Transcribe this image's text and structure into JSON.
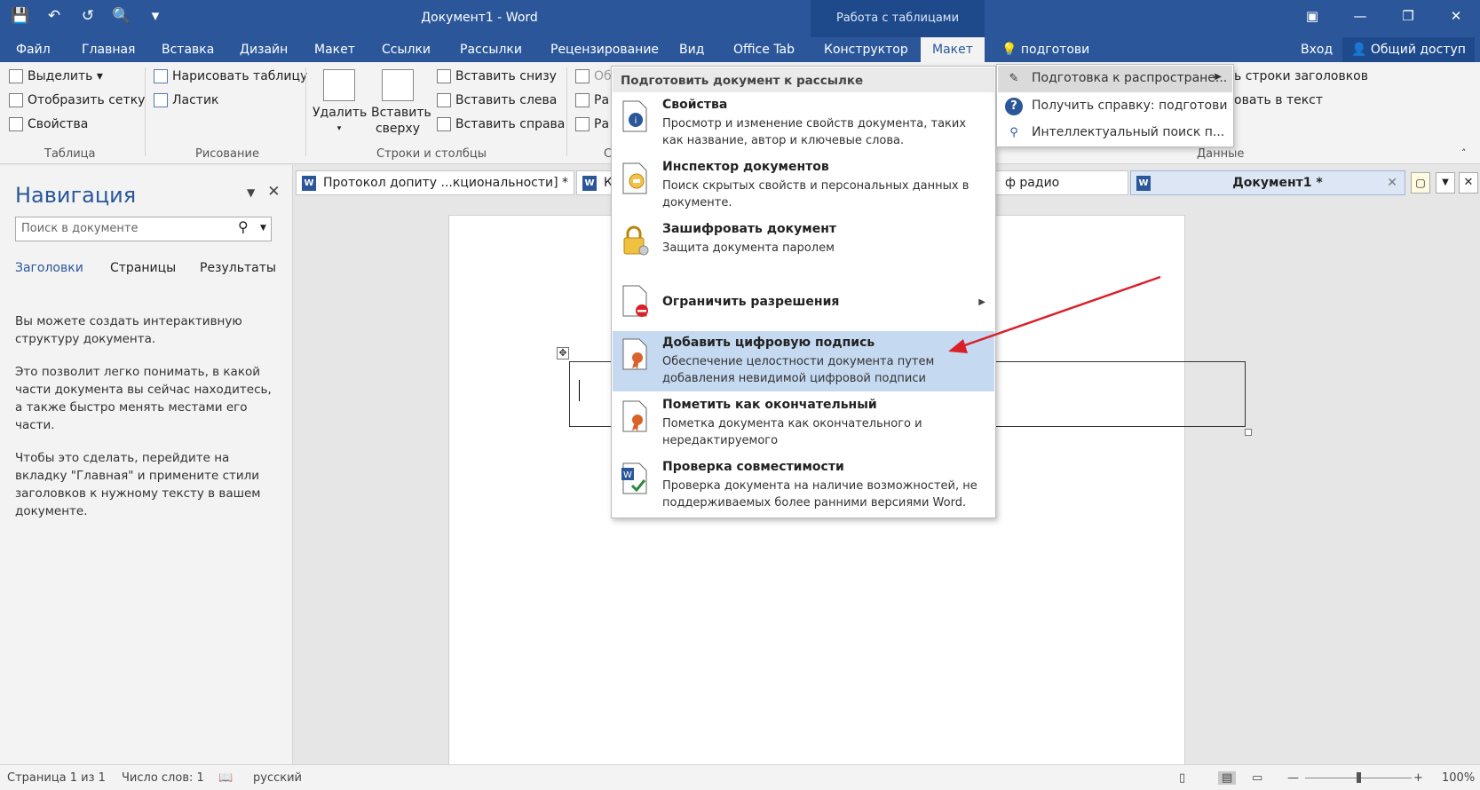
{
  "window": {
    "title": "Документ1 - Word",
    "context_group": "Работа с таблицами",
    "login": "Вход",
    "share": "Общий доступ"
  },
  "qat": {
    "save": "💾",
    "undo": "↶",
    "redo": "↺",
    "preview": "🔍",
    "customize": "▾"
  },
  "tabs": [
    "Файл",
    "Главная",
    "Вставка",
    "Дизайн",
    "Макет",
    "Ссылки",
    "Рассылки",
    "Рецензирование",
    "Вид",
    "Office Tab",
    "Конструктор",
    "Макет",
    "подготови"
  ],
  "ribbon": {
    "table": {
      "select": "Выделить ▾",
      "grid": "Отобразить сетку",
      "props": "Свойства",
      "label": "Таблица"
    },
    "draw": {
      "draw": "Нарисовать таблицу",
      "eraser": "Ластик",
      "label": "Рисование"
    },
    "rows": {
      "delete": "Удалить",
      "insert_above": "Вставить сверху",
      "insert_below": "Вставить снизу",
      "insert_left": "Вставить слева",
      "insert_right": "Вставить справа",
      "label": "Строки и столбцы"
    },
    "merge": {
      "o1": "Об",
      "p1": "Ра",
      "p2": "Ра",
      "label": "С"
    },
    "data": {
      "repeat": "ь строки заголовков",
      "convert": "овать в текст",
      "label": "Данные"
    }
  },
  "nav": {
    "title": "Навигация",
    "search_placeholder": "Поиск в документе",
    "tabs": [
      "Заголовки",
      "Страницы",
      "Результаты"
    ],
    "text": [
      "Вы можете создать интерактивную структуру документа.",
      "Это позволит легко понимать, в какой части документа вы сейчас находитесь, а также быстро менять местами его части.",
      "Чтобы это сделать, перейдите на вкладку \"Главная\" и примените стили заголовков к нужному тексту в вашем документе."
    ]
  },
  "doctabs": [
    "Протокол допиту ...кциональности] *",
    "Ка",
    "ф радио",
    "Документ1 *"
  ],
  "menu": {
    "header": "Подготовить документ к рассылке",
    "items": [
      {
        "title": "Свойства",
        "desc": "Просмотр и изменение свойств документа, таких как название, автор и ключевые слова."
      },
      {
        "title": "Инспектор документов",
        "desc": "Поиск скрытых свойств и персональных данных в документе."
      },
      {
        "title": "Зашифровать документ",
        "desc": "Защита документа паролем"
      },
      {
        "title": "Ограничить разрешения",
        "desc": ""
      },
      {
        "title": "Добавить цифровую подпись",
        "desc": "Обеспечение целостности документа путем добавления невидимой цифровой подписи"
      },
      {
        "title": "Пометить как окончательный",
        "desc": "Пометка документа как окончательного и нередактируемого"
      },
      {
        "title": "Проверка совместимости",
        "desc": "Проверка документа на наличие возможностей, не поддерживаемых более ранними версиями Word."
      }
    ]
  },
  "submenu": [
    "Подготовка к распростране...",
    "Получить справку: подготови",
    "Интеллектуальный поиск п..."
  ],
  "status": {
    "page": "Страница 1 из 1",
    "words": "Число слов: 1",
    "lang": "русский",
    "zoom": "100%"
  },
  "colors": {
    "accent": "#2b579a",
    "highlight": "#c5d9f1",
    "arrow": "#d9212a"
  }
}
